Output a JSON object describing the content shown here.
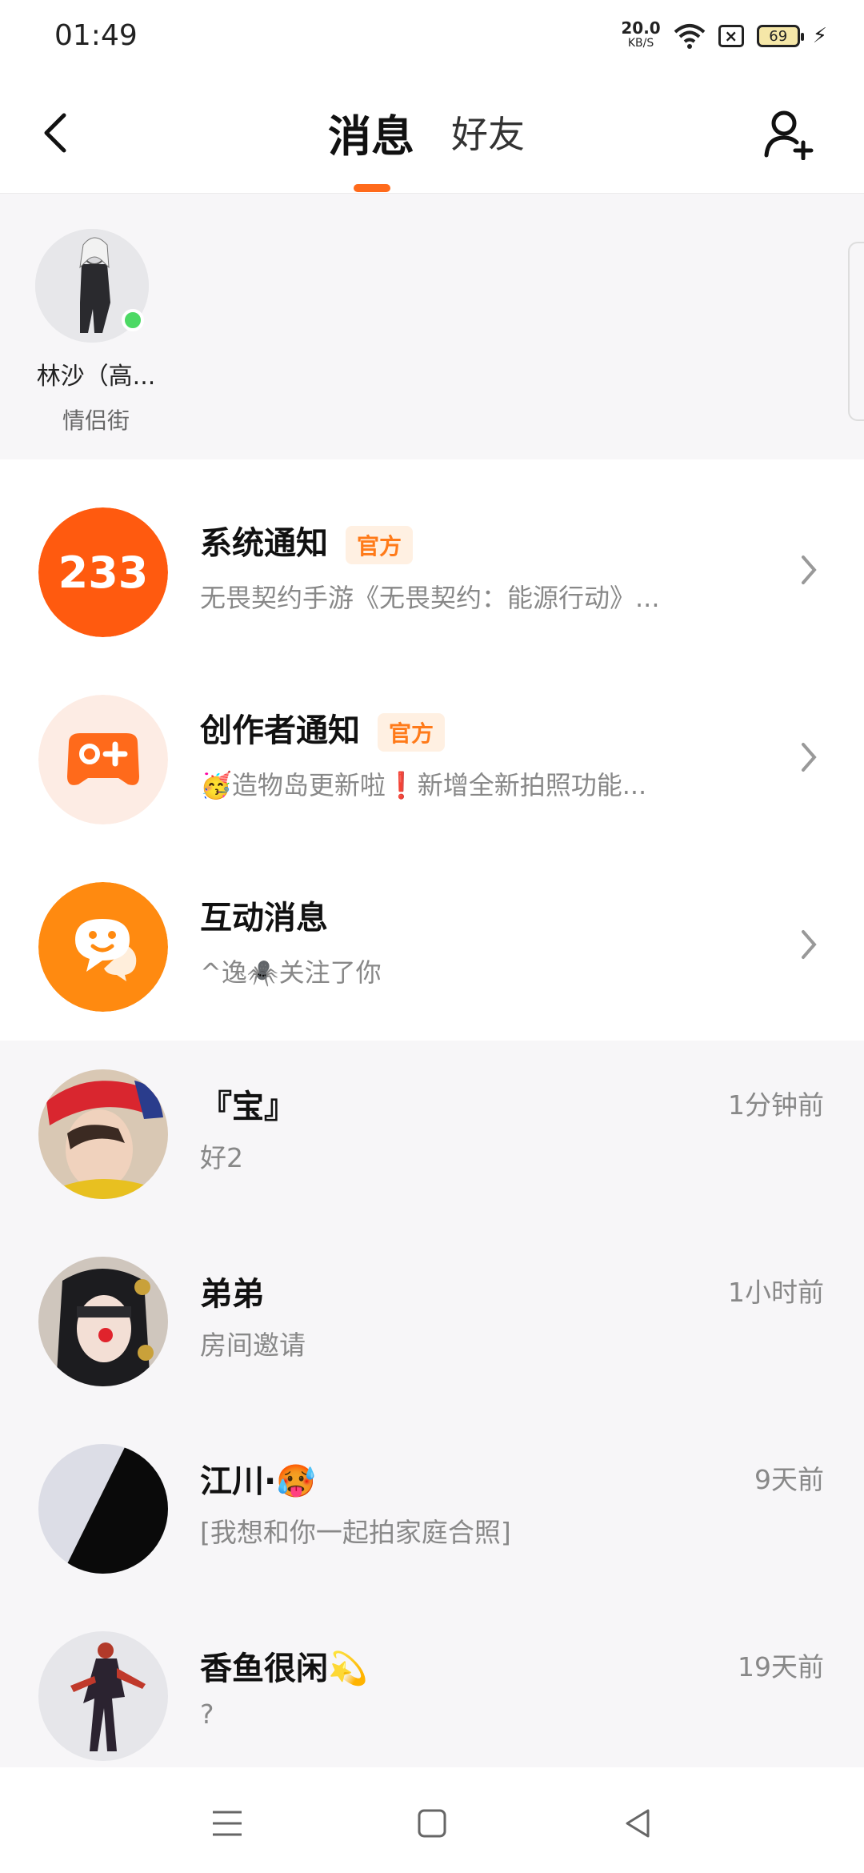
{
  "status": {
    "time": "01:49",
    "speed": "20.0",
    "speed_unit": "KB/S",
    "battery": "69"
  },
  "header": {
    "tab_messages": "消息",
    "tab_friends": "好友"
  },
  "favorite_friend": {
    "name": "林沙（高...",
    "tag": "情侣街",
    "online": true
  },
  "notifications": [
    {
      "title": "系统通知",
      "badge": "官方",
      "subtitle": "无畏契约手游《无畏契约：能源行动》...",
      "icon": "233-logo-icon",
      "icon_text": "233",
      "color": "#ff5a0f"
    },
    {
      "title": "创作者通知",
      "badge": "官方",
      "subtitle": "🥳造物岛更新啦❗新增全新拍照功能...",
      "icon": "gamepad-plus-icon",
      "icon_text": "",
      "color": "#ff6a1b"
    },
    {
      "title": "互动消息",
      "badge": "",
      "subtitle": "^逸🕷️关注了你",
      "icon": "chat-smile-icon",
      "icon_text": "",
      "color": "#ff8a10"
    }
  ],
  "chats": [
    {
      "name": "『宝』",
      "message": "好2",
      "time": "1分钟前"
    },
    {
      "name": "弟弟",
      "message": "房间邀请",
      "time": "1小时前"
    },
    {
      "name": "江川·🥵",
      "message": "[我想和你一起拍家庭合照]",
      "time": "9天前"
    },
    {
      "name": "香鱼很闲💫",
      "message": "?",
      "time": "19天前"
    }
  ]
}
